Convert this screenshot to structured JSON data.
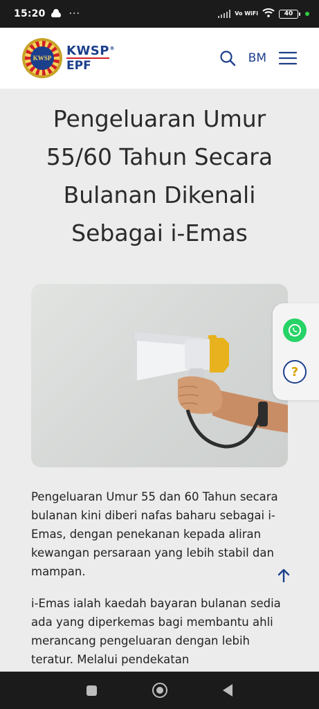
{
  "status_bar": {
    "time": "15:20",
    "more": "···",
    "network": "Vo WiFi",
    "battery": "40"
  },
  "header": {
    "logo_kwsp": "KWSP",
    "logo_epf": "EPF",
    "logo_reg": "®",
    "logo_badge": "KWSP",
    "language": "BM"
  },
  "article": {
    "title": "Pengeluaran Umur 55/60 Tahun Secara Bulanan Dikenali Sebagai i-Emas",
    "paragraph_1": "Pengeluaran Umur 55 dan 60 Tahun secara bulanan kini diberi nafas baharu sebagai i-Emas, dengan penekanan kepada aliran kewangan persaraan yang lebih stabil dan mampan.",
    "paragraph_2": "i-Emas ialah kaedah bayaran bulanan sedia ada yang diperkemas bagi membantu ahli merancang pengeluaran dengan lebih teratur. Melalui pendekatan"
  },
  "side_widget": {
    "help_label": "?"
  },
  "colors": {
    "brand_blue": "#1c3f8c",
    "brand_red": "#d21f26",
    "whatsapp_green": "#25d366",
    "help_yellow": "#d9a400"
  },
  "icons": {
    "search": "search-icon",
    "menu": "hamburger-menu-icon",
    "whatsapp": "whatsapp-icon",
    "help": "help-icon",
    "scroll_top": "arrow-up-icon"
  }
}
